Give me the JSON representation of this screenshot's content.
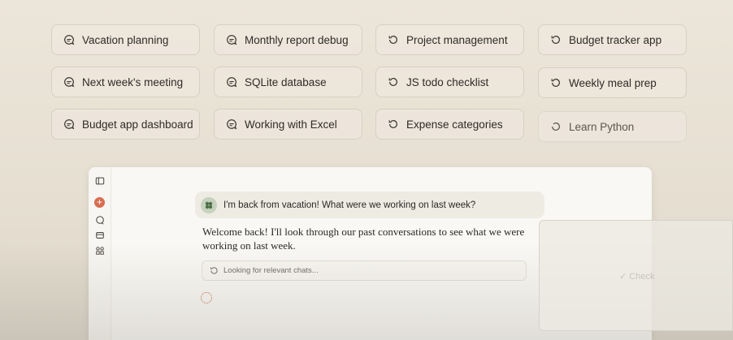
{
  "suggestions": [
    {
      "label": "Vacation planning",
      "icon": "chat-bubble-icon"
    },
    {
      "label": "Monthly report debug",
      "icon": "chat-bubble-icon"
    },
    {
      "label": "Project management",
      "icon": "history-icon"
    },
    {
      "label": "Budget tracker app",
      "icon": "history-icon"
    },
    {
      "label": "Next week's meeting",
      "icon": "chat-bubble-icon"
    },
    {
      "label": "SQLite database",
      "icon": "chat-bubble-icon"
    },
    {
      "label": "JS todo checklist",
      "icon": "history-icon"
    },
    {
      "label": "Weekly meal prep",
      "icon": "history-icon"
    },
    {
      "label": "Budget app dashboard",
      "icon": "chat-bubble-icon"
    },
    {
      "label": "Working with Excel",
      "icon": "chat-bubble-icon"
    },
    {
      "label": "Expense categories",
      "icon": "history-icon"
    },
    {
      "label": "Learn Python",
      "icon": "history-icon"
    }
  ],
  "chat": {
    "user_message": "I'm back from vacation! What were we working on last week?",
    "assistant_reply": "Welcome back! I'll look through our past conversations to see what we were working on last week.",
    "tool_status": "Looking for relevant chats..."
  },
  "sidebar": {
    "icons": [
      "sidebar-toggle-icon",
      "new-chat-icon",
      "chats-icon",
      "projects-icon",
      "artifacts-icon"
    ]
  },
  "overlay": {
    "caption": "",
    "button_text": "✓ Check"
  },
  "colors": {
    "accent": "#d96c4f",
    "background": "#ece5d9",
    "panel": "#f9f8f4"
  }
}
